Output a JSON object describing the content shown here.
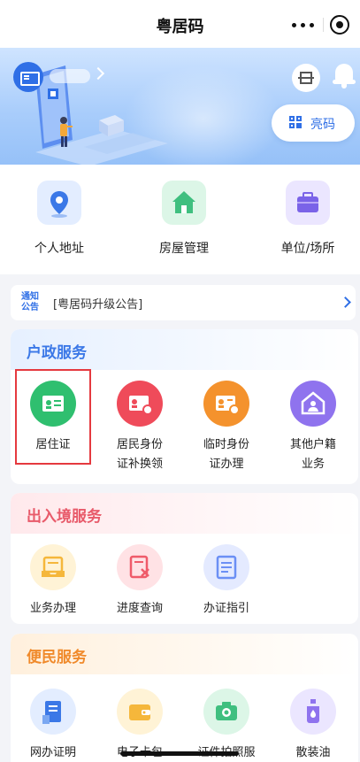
{
  "app": {
    "title": "粤居码"
  },
  "capsule": {
    "more_icon": "more-dots-icon",
    "close_icon": "target-circle-icon"
  },
  "banner": {
    "show_code_label": "亮码",
    "user_name": ""
  },
  "quick_actions": [
    {
      "label": "个人地址",
      "icon": "location-pin-icon",
      "color": "#3b78e7"
    },
    {
      "label": "房屋管理",
      "icon": "house-icon",
      "color": "#3fbf7f"
    },
    {
      "label": "单位/场所",
      "icon": "briefcase-icon",
      "color": "#7a63e8"
    }
  ],
  "notice": {
    "tag_line1": "通知",
    "tag_line2": "公告",
    "text": "[粤居码升级公告]"
  },
  "sections": {
    "household": {
      "title": "户政服务",
      "items": [
        {
          "label_line1": "居住证",
          "label_line2": "",
          "icon": "id-card-icon",
          "color": "#2fbf6f"
        },
        {
          "label_line1": "居民身份",
          "label_line2": "证补换领",
          "icon": "id-card-refresh-icon",
          "color": "#ef4b5a"
        },
        {
          "label_line1": "临时身份",
          "label_line2": "证办理",
          "icon": "temp-id-badge-icon",
          "color": "#f4922d"
        },
        {
          "label_line1": "其他户籍",
          "label_line2": "业务",
          "icon": "home-person-icon",
          "color": "#8f73ee"
        }
      ]
    },
    "entry_exit": {
      "title": "出入境服务",
      "items": [
        {
          "label": "业务办理",
          "icon": "inbox-tray-icon",
          "color": "#f5b73b"
        },
        {
          "label": "进度查询",
          "icon": "document-x-icon",
          "color": "#ef5b6a"
        },
        {
          "label": "办证指引",
          "icon": "guide-book-icon",
          "color": "#6b8ff5"
        }
      ]
    },
    "convenience": {
      "title": "便民服务",
      "items": [
        {
          "label": "网办证明",
          "icon": "certificate-icon",
          "color": "#3b78e7"
        },
        {
          "label": "电子卡包",
          "icon": "wallet-icon",
          "color": "#f5b73b"
        },
        {
          "label": "证件拍照服",
          "icon": "camera-id-icon",
          "color": "#3fbf7f"
        },
        {
          "label": "散装油",
          "icon": "oil-bottle-icon",
          "color": "#8f73ee"
        }
      ]
    }
  }
}
